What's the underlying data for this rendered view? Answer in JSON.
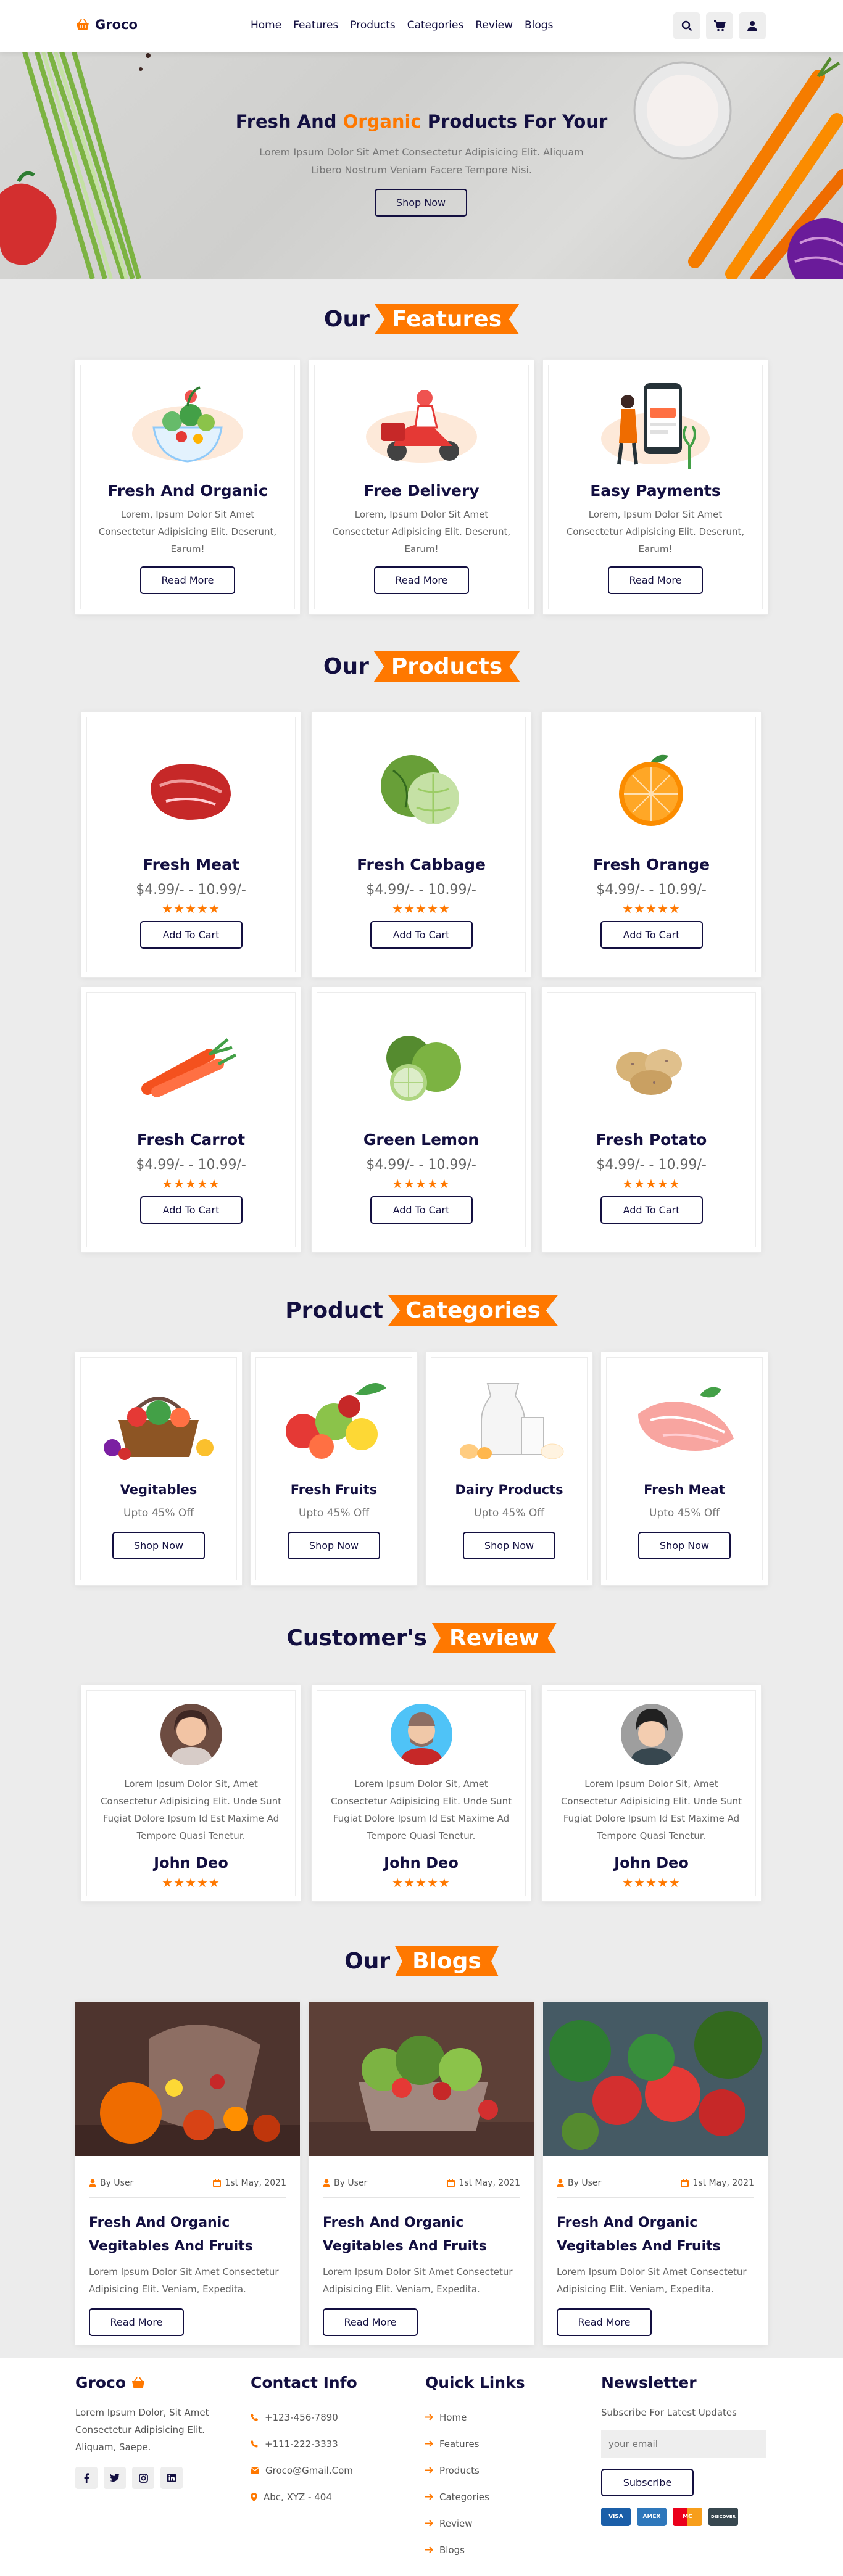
{
  "colors": {
    "accent": "#ff7800",
    "dark": "#130f40",
    "muted": "#666666",
    "bg": "#ececec"
  },
  "header": {
    "brand": "Groco",
    "nav": [
      "Home",
      "Features",
      "Products",
      "Categories",
      "Review",
      "Blogs"
    ],
    "icons": [
      "search-icon",
      "cart-icon",
      "user-icon"
    ]
  },
  "hero": {
    "title_part1": "Fresh And ",
    "title_accent": "Organic",
    "title_part2": " Products For Your",
    "text": "Lorem Ipsum Dolor Sit Amet Consectetur Adipisicing Elit. Aliquam Libero Nostrum Veniam Facere Tempore Nisi.",
    "button": "Shop Now"
  },
  "features": {
    "heading": "Our",
    "heading_accent": "Features",
    "items": [
      {
        "title": "Fresh And Organic",
        "text": "Lorem, Ipsum Dolor Sit Amet Consectetur Adipisicing Elit. Deserunt, Earum!",
        "button": "Read More"
      },
      {
        "title": "Free Delivery",
        "text": "Lorem, Ipsum Dolor Sit Amet Consectetur Adipisicing Elit. Deserunt, Earum!",
        "button": "Read More"
      },
      {
        "title": "Easy Payments",
        "text": "Lorem, Ipsum Dolor Sit Amet Consectetur Adipisicing Elit. Deserunt, Earum!",
        "button": "Read More"
      }
    ]
  },
  "products": {
    "heading": "Our",
    "heading_accent": "Products",
    "items": [
      {
        "name": "Fresh Meat",
        "price": "$4.99/- - 10.99/-",
        "rating": 4.5,
        "stars": "★★★★★",
        "button": "Add To Cart"
      },
      {
        "name": "Fresh Cabbage",
        "price": "$4.99/- - 10.99/-",
        "rating": 4.5,
        "stars": "★★★★★",
        "button": "Add To Cart"
      },
      {
        "name": "Fresh Orange",
        "price": "$4.99/- - 10.99/-",
        "rating": 4.5,
        "stars": "★★★★★",
        "button": "Add To Cart"
      },
      {
        "name": "Fresh Carrot",
        "price": "$4.99/- - 10.99/-",
        "rating": 4.5,
        "stars": "★★★★★",
        "button": "Add To Cart"
      },
      {
        "name": "Green Lemon",
        "price": "$4.99/- - 10.99/-",
        "rating": 4.5,
        "stars": "★★★★★",
        "button": "Add To Cart"
      },
      {
        "name": "Fresh Potato",
        "price": "$4.99/- - 10.99/-",
        "rating": 4.5,
        "stars": "★★★★★",
        "button": "Add To Cart"
      }
    ]
  },
  "categories": {
    "heading": "Product",
    "heading_accent": "Categories",
    "items": [
      {
        "name": "Vegitables",
        "offer": "Upto 45% Off",
        "button": "Shop Now"
      },
      {
        "name": "Fresh Fruits",
        "offer": "Upto 45% Off",
        "button": "Shop Now"
      },
      {
        "name": "Dairy Products",
        "offer": "Upto 45% Off",
        "button": "Shop Now"
      },
      {
        "name": "Fresh Meat",
        "offer": "Upto 45% Off",
        "button": "Shop Now"
      }
    ]
  },
  "reviews": {
    "heading": "Customer's",
    "heading_accent": "Review",
    "items": [
      {
        "text": "Lorem Ipsum Dolor Sit, Amet Consectetur Adipisicing Elit. Unde Sunt Fugiat Dolore Ipsum Id Est Maxime Ad Tempore Quasi Tenetur.",
        "name": "John Deo",
        "rating": 4.5,
        "stars": "★★★★★"
      },
      {
        "text": "Lorem Ipsum Dolor Sit, Amet Consectetur Adipisicing Elit. Unde Sunt Fugiat Dolore Ipsum Id Est Maxime Ad Tempore Quasi Tenetur.",
        "name": "John Deo",
        "rating": 4.5,
        "stars": "★★★★★"
      },
      {
        "text": "Lorem Ipsum Dolor Sit, Amet Consectetur Adipisicing Elit. Unde Sunt Fugiat Dolore Ipsum Id Est Maxime Ad Tempore Quasi Tenetur.",
        "name": "John Deo",
        "rating": 4.5,
        "stars": "★★★★★"
      }
    ]
  },
  "blogs": {
    "heading": "Our",
    "heading_accent": "Blogs",
    "items": [
      {
        "author": "By User",
        "date": "1st May, 2021",
        "title": "Fresh And Organic Vegitables And Fruits",
        "text": "Lorem Ipsum Dolor Sit Amet Consectetur Adipisicing Elit. Veniam, Expedita.",
        "button": "Read More"
      },
      {
        "author": "By User",
        "date": "1st May, 2021",
        "title": "Fresh And Organic Vegitables And Fruits",
        "text": "Lorem Ipsum Dolor Sit Amet Consectetur Adipisicing Elit. Veniam, Expedita.",
        "button": "Read More"
      },
      {
        "author": "By User",
        "date": "1st May, 2021",
        "title": "Fresh And Organic Vegitables And Fruits",
        "text": "Lorem Ipsum Dolor Sit Amet Consectetur Adipisicing Elit. Veniam, Expedita.",
        "button": "Read More"
      }
    ]
  },
  "footer": {
    "brand": "Groco",
    "about": "Lorem Ipsum Dolor, Sit Amet Consectetur Adipisicing Elit. Aliquam, Saepe.",
    "social": [
      "facebook-icon",
      "twitter-icon",
      "instagram-icon",
      "linkedin-icon"
    ],
    "contact_title": "Contact Info",
    "contact": [
      "+123-456-7890",
      "+111-222-3333",
      "Groco@Gmail.Com",
      "Abc, XYZ - 404"
    ],
    "links_title": "Quick Links",
    "links": [
      "Home",
      "Features",
      "Products",
      "Categories",
      "Review",
      "Blogs"
    ],
    "newsletter_title": "Newsletter",
    "newsletter_text": "Subscribe For Latest Updates",
    "email_placeholder": "your email",
    "subscribe": "Subscribe",
    "payments": [
      "VISA",
      "AMEX",
      "MC",
      "DISCOVER"
    ]
  }
}
